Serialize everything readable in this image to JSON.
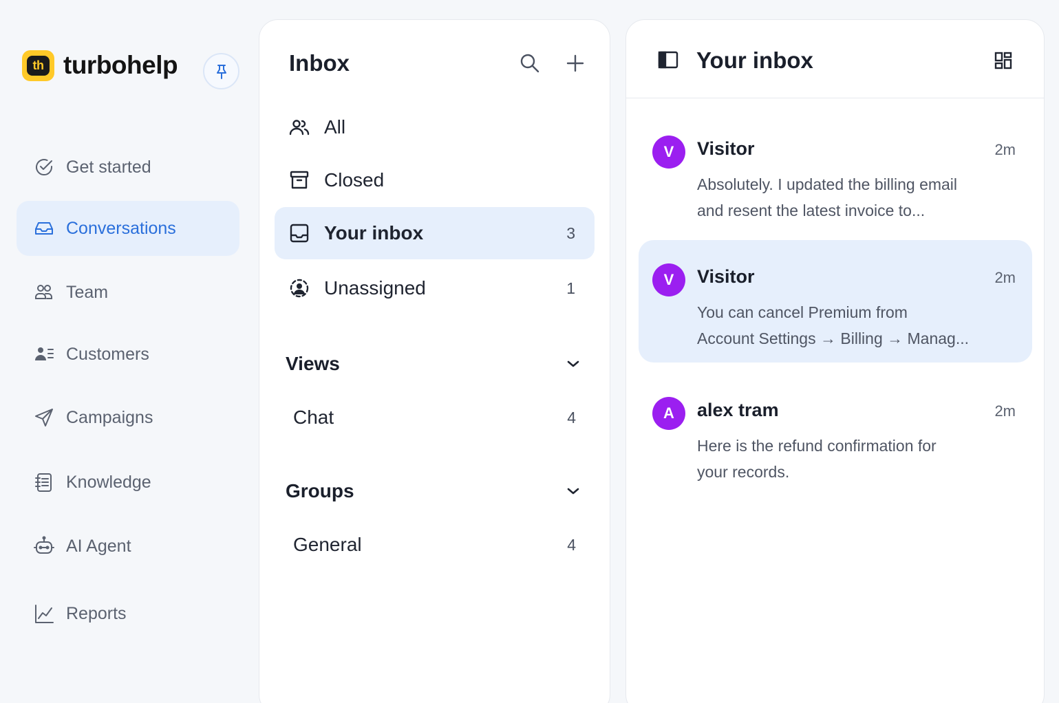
{
  "brand": {
    "logo_text": "th",
    "name": "turbohelp"
  },
  "sidebar": {
    "items": [
      {
        "label": "Get started",
        "icon": "check-circle-icon"
      },
      {
        "label": "Conversations",
        "icon": "inbox-tray-icon",
        "active": true
      },
      {
        "label": "Team",
        "icon": "team-icon"
      },
      {
        "label": "Customers",
        "icon": "customers-icon"
      },
      {
        "label": "Campaigns",
        "icon": "send-icon"
      },
      {
        "label": "Knowledge",
        "icon": "notebook-icon"
      },
      {
        "label": "AI Agent",
        "icon": "robot-icon"
      },
      {
        "label": "Reports",
        "icon": "chart-line-icon"
      }
    ]
  },
  "inbox_panel": {
    "title": "Inbox",
    "items": [
      {
        "label": "All",
        "count": "",
        "icon": "users-icon"
      },
      {
        "label": "Closed",
        "count": "",
        "icon": "archive-icon"
      },
      {
        "label": "Your inbox",
        "count": "3",
        "icon": "inbox-icon",
        "active": true
      },
      {
        "label": "Unassigned",
        "count": "1",
        "icon": "unassigned-icon"
      }
    ],
    "views": {
      "label": "Views",
      "items": [
        {
          "label": "Chat",
          "count": "4"
        }
      ]
    },
    "groups": {
      "label": "Groups",
      "items": [
        {
          "label": "General",
          "count": "4"
        }
      ]
    }
  },
  "conversation_list": {
    "title": "Your inbox",
    "items": [
      {
        "avatar": "V",
        "name": "Visitor",
        "time": "2m",
        "line1": "Absolutely. I updated the billing email",
        "line2": "and resent the latest invoice to..."
      },
      {
        "avatar": "V",
        "name": "Visitor",
        "time": "2m",
        "line1": "You can cancel Premium from",
        "line2": "Account Settings → Billing → Manag...",
        "active": true
      },
      {
        "avatar": "A",
        "name": "alex tram",
        "time": "2m",
        "line1": "Here is the refund confirmation for",
        "line2": "your records."
      }
    ]
  },
  "colors": {
    "accent": "#2a6fdb",
    "active_bg": "#e6effc",
    "avatar": "#9b1ff0",
    "logo": "#ffc928"
  }
}
